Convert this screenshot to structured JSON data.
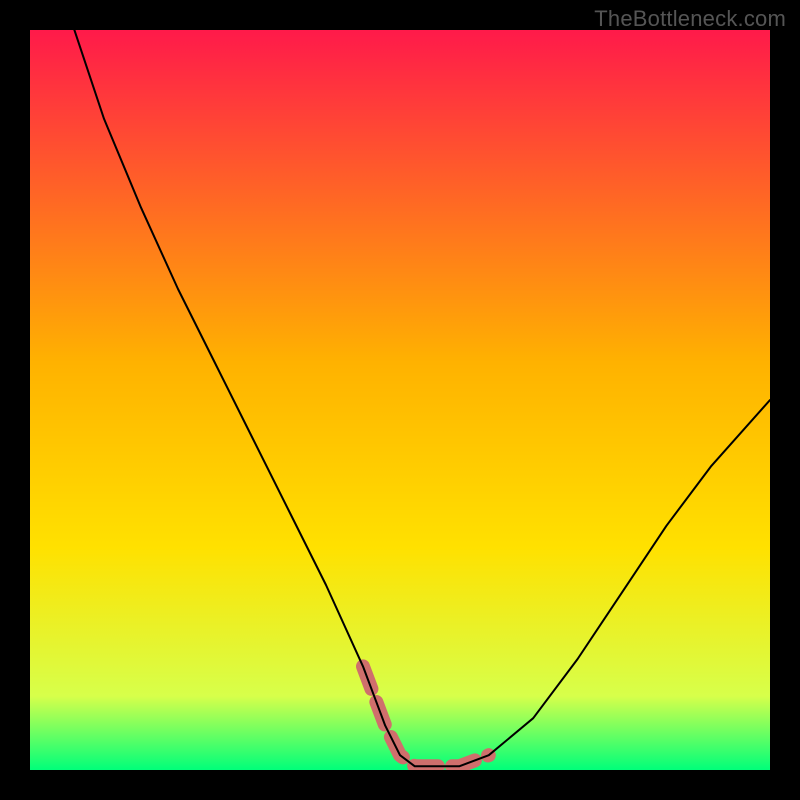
{
  "watermark": "TheBottleneck.com",
  "colors": {
    "frame": "#000000",
    "watermark": "#555555",
    "curve": "#000000",
    "highlight": "#cf6f6c",
    "bg_red": "#ff1a4a",
    "bg_yellow": "#ffe100",
    "bg_green": "#00ff7a"
  },
  "chart_data": {
    "type": "line",
    "title": "",
    "xlabel": "",
    "ylabel": "",
    "xlim": [
      0,
      100
    ],
    "ylim": [
      0,
      100
    ],
    "series": [
      {
        "name": "bottleneck-curve",
        "x": [
          6,
          10,
          15,
          20,
          25,
          30,
          35,
          40,
          45,
          48,
          50,
          52,
          55,
          58,
          62,
          68,
          74,
          80,
          86,
          92,
          100
        ],
        "y": [
          100,
          88,
          76,
          65,
          55,
          45,
          35,
          25,
          14,
          6,
          2,
          0.5,
          0.5,
          0.5,
          2,
          7,
          15,
          24,
          33,
          41,
          50
        ]
      }
    ],
    "highlight_segment": {
      "x": [
        45,
        48,
        50,
        52,
        55,
        58,
        62
      ],
      "y": [
        14,
        6,
        2,
        0.5,
        0.5,
        0.5,
        2
      ]
    },
    "gradient_stops": [
      {
        "offset": 0.0,
        "color": "#ff1a4a"
      },
      {
        "offset": 0.45,
        "color": "#ffb200"
      },
      {
        "offset": 0.7,
        "color": "#ffe100"
      },
      {
        "offset": 0.9,
        "color": "#d7ff4a"
      },
      {
        "offset": 1.0,
        "color": "#00ff7a"
      }
    ]
  }
}
